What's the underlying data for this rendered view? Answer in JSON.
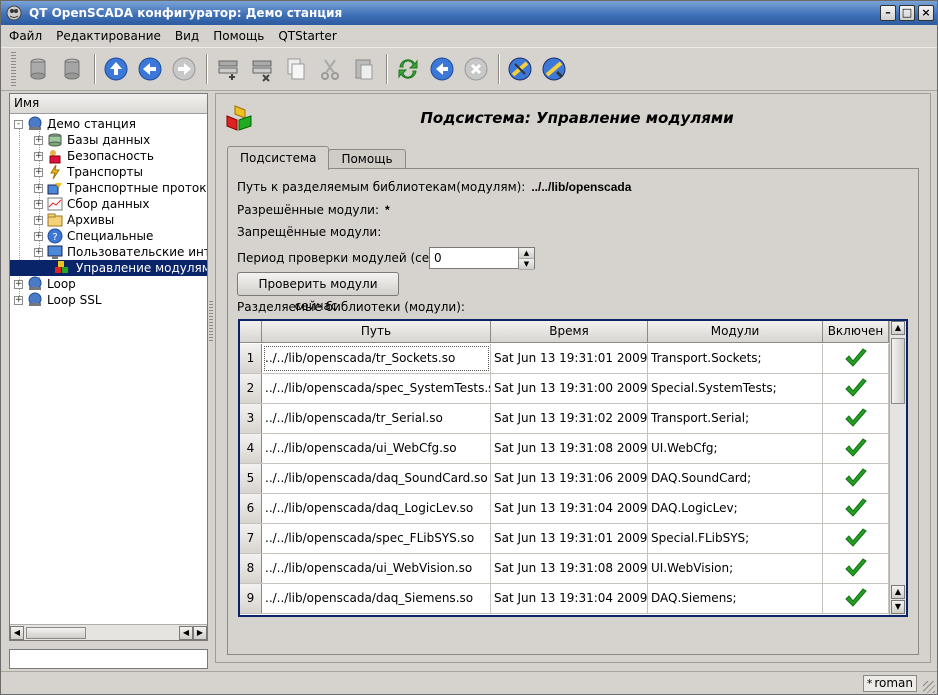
{
  "window": {
    "title": "QT OpenSCADA конфигуратор: Демо станция"
  },
  "menu": [
    {
      "label": "Файл"
    },
    {
      "label": "Редактирование"
    },
    {
      "label": "Вид"
    },
    {
      "label": "Помощь"
    },
    {
      "label": "QTStarter"
    }
  ],
  "toolbar": [
    {
      "name": "db-load-icon"
    },
    {
      "name": "db-save-icon"
    },
    {
      "name": "up-icon"
    },
    {
      "name": "back-icon"
    },
    {
      "name": "forward-icon"
    },
    {
      "name": "item-add-icon"
    },
    {
      "name": "item-delete-icon"
    },
    {
      "name": "copy-icon"
    },
    {
      "name": "cut-icon"
    },
    {
      "name": "paste-icon"
    },
    {
      "name": "refresh-icon"
    },
    {
      "name": "start-icon"
    },
    {
      "name": "stop-icon"
    },
    {
      "name": "help-icon"
    },
    {
      "name": "what-is-this-icon"
    }
  ],
  "tree": {
    "header": "Имя",
    "nodes": [
      {
        "label": "Демо станция",
        "icon": "station-icon",
        "expander": "-"
      },
      {
        "label": "Базы данных",
        "icon": "database-icon",
        "expander": "+"
      },
      {
        "label": "Безопасность",
        "icon": "security-icon",
        "expander": "+"
      },
      {
        "label": "Транспорты",
        "icon": "transport-icon",
        "expander": "+"
      },
      {
        "label": "Транспортные протоко",
        "icon": "protocol-icon",
        "expander": "+"
      },
      {
        "label": "Сбор данных",
        "icon": "daq-icon",
        "expander": "+"
      },
      {
        "label": "Архивы",
        "icon": "archive-icon",
        "expander": "+"
      },
      {
        "label": "Специальные",
        "icon": "special-icon",
        "expander": "+"
      },
      {
        "label": "Пользовательские инт",
        "icon": "ui-icon",
        "expander": "+"
      },
      {
        "label": "Управление модулями",
        "icon": "modules-icon",
        "expander": ""
      },
      {
        "label": "Loop",
        "icon": "station-icon",
        "expander": "+"
      },
      {
        "label": "Loop SSL",
        "icon": "station-icon",
        "expander": "+"
      }
    ]
  },
  "page": {
    "title": "Подсистема: Управление модулями",
    "tabs": [
      {
        "label": "Подсистема",
        "active": true
      },
      {
        "label": "Помощь",
        "active": false
      }
    ],
    "lib_path_label": "Путь к разделяемым библиотекам(модулям):",
    "lib_path_value": "../../lib/openscada",
    "allowed_label": "Разрешённые модули:",
    "allowed_value": "*",
    "denied_label": "Запрещённые модули:",
    "period_label": "Период проверки модулей (сек):",
    "period_value": "0",
    "check_button": "Проверить модули сейчас.",
    "libs_label": "Разделяемые библиотеки (модули):"
  },
  "table": {
    "columns": [
      "Путь",
      "Время",
      "Модули",
      "Включен"
    ],
    "rows": [
      {
        "n": "1",
        "path": "../../lib/openscada/tr_Sockets.so",
        "time": "Sat Jun 13 19:31:01 2009",
        "modules": "Transport.Sockets;",
        "enabled": true
      },
      {
        "n": "2",
        "path": "../../lib/openscada/spec_SystemTests.so",
        "time": "Sat Jun 13 19:31:00 2009",
        "modules": "Special.SystemTests;",
        "enabled": true
      },
      {
        "n": "3",
        "path": "../../lib/openscada/tr_Serial.so",
        "time": "Sat Jun 13 19:31:02 2009",
        "modules": "Transport.Serial;",
        "enabled": true
      },
      {
        "n": "4",
        "path": "../../lib/openscada/ui_WebCfg.so",
        "time": "Sat Jun 13 19:31:08 2009",
        "modules": "UI.WebCfg;",
        "enabled": true
      },
      {
        "n": "5",
        "path": "../../lib/openscada/daq_SoundCard.so",
        "time": "Sat Jun 13 19:31:06 2009",
        "modules": "DAQ.SoundCard;",
        "enabled": true
      },
      {
        "n": "6",
        "path": "../../lib/openscada/daq_LogicLev.so",
        "time": "Sat Jun 13 19:31:04 2009",
        "modules": "DAQ.LogicLev;",
        "enabled": true
      },
      {
        "n": "7",
        "path": "../../lib/openscada/spec_FLibSYS.so",
        "time": "Sat Jun 13 19:31:01 2009",
        "modules": "Special.FLibSYS;",
        "enabled": true
      },
      {
        "n": "8",
        "path": "../../lib/openscada/ui_WebVision.so",
        "time": "Sat Jun 13 19:31:08 2009",
        "modules": "UI.WebVision;",
        "enabled": true
      },
      {
        "n": "9",
        "path": "../../lib/openscada/daq_Siemens.so",
        "time": "Sat Jun 13 19:31:04 2009",
        "modules": "DAQ.Siemens;",
        "enabled": true
      }
    ]
  },
  "status": {
    "modified_mark": "*",
    "user": "roman"
  },
  "colors": {
    "title_bar": "#3d6eb5",
    "selection": "#0a246a",
    "check": "#22a022"
  }
}
